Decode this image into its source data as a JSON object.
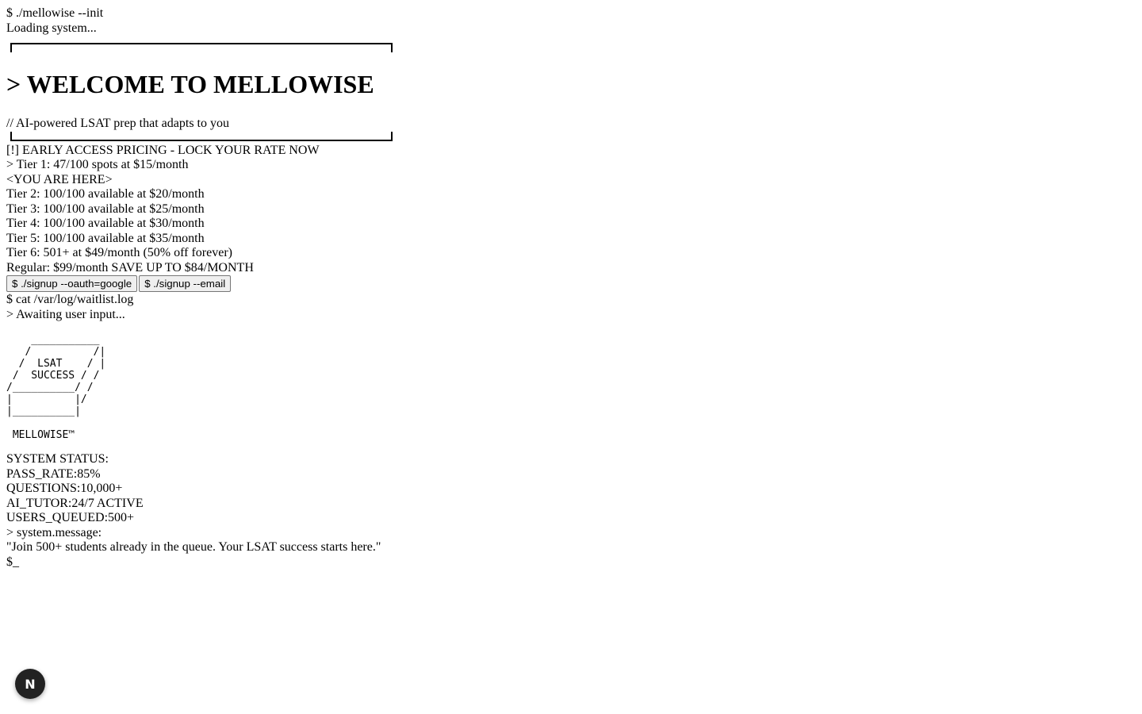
{
  "boot": {
    "command": "$ ./mellowise --init",
    "loading": "Loading system..."
  },
  "hero": {
    "title": "> WELCOME TO MELLOWISE",
    "tagline": "// AI-powered LSAT prep that adapts to you"
  },
  "pricing": {
    "header": "[!] EARLY ACCESS PRICING - LOCK YOUR RATE NOW",
    "current_tier": "> Tier 1: 47/100 spots at $15/month",
    "you_are_here": "<YOU ARE HERE>",
    "tiers": [
      "Tier 2: 100/100 available at $20/month",
      "Tier 3: 100/100 available at $25/month",
      "Tier 4: 100/100 available at $30/month",
      "Tier 5: 100/100 available at $35/month",
      "Tier 6: 501+ at $49/month (50% off forever)"
    ],
    "regular": "Regular: $99/month SAVE UP TO $84/MONTH"
  },
  "signup": {
    "google_label": "$ ./signup --oauth=google",
    "email_label": "$ ./signup --email"
  },
  "log": {
    "command": "$ cat /var/log/waitlist.log",
    "awaiting": "> Awaiting user input..."
  },
  "ascii_art": "    ___________\n   /          /|\n  /  LSAT    / |\n /  SUCCESS / /\n/__________/ /\n|          |/\n|__________|\n\n MELLOWISE™",
  "status": {
    "header": "SYSTEM STATUS:",
    "items": [
      "PASS_RATE:85%",
      "QUESTIONS:10,000+",
      "AI_TUTOR:24/7 ACTIVE",
      "USERS_QUEUED:500+"
    ]
  },
  "message": {
    "label": "> system.message:",
    "text": "\"Join 500+ students already in the queue. Your LSAT success starts here.\""
  },
  "prompt": "$_",
  "badge": {
    "letter": "N",
    "icon": "next-n-icon"
  }
}
